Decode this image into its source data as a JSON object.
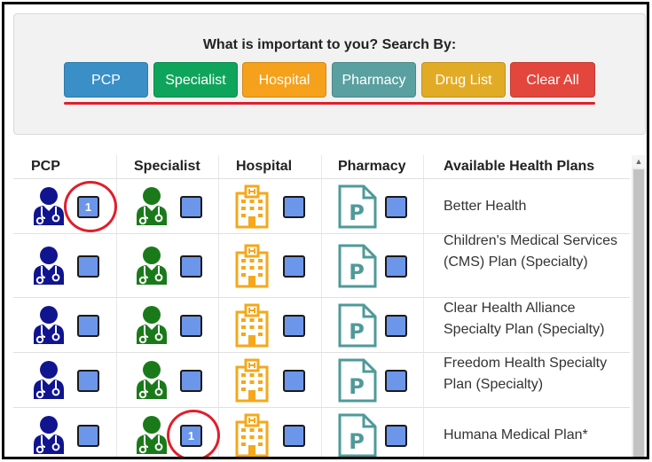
{
  "search": {
    "title": "What is important to you? Search By:",
    "buttons": [
      {
        "label": "PCP",
        "color": "#3a8fc6"
      },
      {
        "label": "Specialist",
        "color": "#0fa45b"
      },
      {
        "label": "Hospital",
        "color": "#f5a11b"
      },
      {
        "label": "Pharmacy",
        "color": "#5aa0a0"
      },
      {
        "label": "Drug List",
        "color": "#e2ab25"
      },
      {
        "label": "Clear All",
        "color": "#e3463c"
      }
    ],
    "underline_color": "#e01f2b"
  },
  "table": {
    "headers": [
      "PCP",
      "Specialist",
      "Hospital",
      "Pharmacy",
      "Available Health Plans"
    ],
    "icons": {
      "pcp": {
        "name": "doctor-icon",
        "color": "#10148f"
      },
      "specialist": {
        "name": "doctor-icon",
        "color": "#1a7a1a"
      },
      "hospital": {
        "name": "hospital-icon",
        "color": "#f5a81b"
      },
      "pharmacy": {
        "name": "pharmacy-document-icon",
        "color": "#4f9a9a"
      }
    },
    "rows": [
      {
        "plan": "Better Health",
        "pcp_badge": "1",
        "specialist_badge": "",
        "hospital_badge": "",
        "pharmacy_badge": ""
      },
      {
        "plan": "Children's Medical Services (CMS) Plan (Specialty)",
        "pcp_badge": "",
        "specialist_badge": "",
        "hospital_badge": "",
        "pharmacy_badge": ""
      },
      {
        "plan": "Clear Health Alliance Specialty Plan (Specialty)",
        "pcp_badge": "",
        "specialist_badge": "",
        "hospital_badge": "",
        "pharmacy_badge": ""
      },
      {
        "plan": "Freedom Health Specialty Plan (Specialty)",
        "pcp_badge": "",
        "specialist_badge": "",
        "hospital_badge": "",
        "pharmacy_badge": ""
      },
      {
        "plan": "Humana Medical Plan*",
        "pcp_badge": "",
        "specialist_badge": "1",
        "hospital_badge": "",
        "pharmacy_badge": ""
      }
    ],
    "badge_color": "#6b96ea",
    "highlight_color": "#e01f2b",
    "pharmacy_glyph": "P"
  }
}
